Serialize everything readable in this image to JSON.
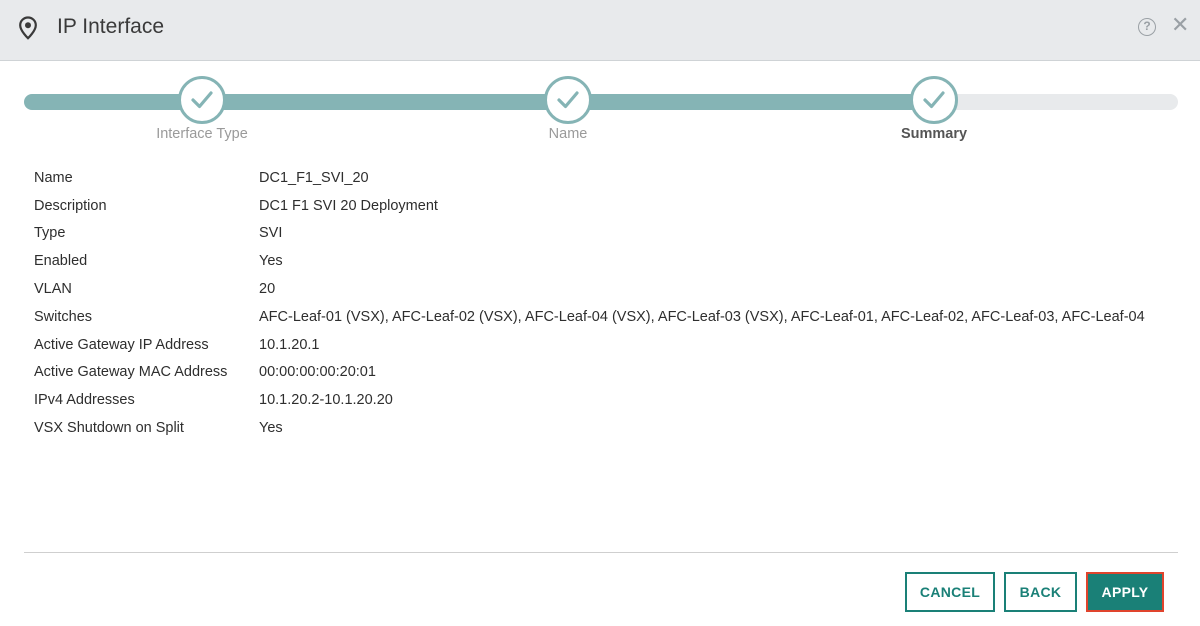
{
  "header": {
    "title": "IP Interface",
    "help_glyph": "?",
    "close_glyph": "✕"
  },
  "stepper": {
    "steps": [
      {
        "label": "Interface Type",
        "state": "complete"
      },
      {
        "label": "Name",
        "state": "complete"
      },
      {
        "label": "Summary",
        "state": "active"
      }
    ]
  },
  "summary": {
    "rows": [
      {
        "key": "Name",
        "value": "DC1_F1_SVI_20"
      },
      {
        "key": "Description",
        "value": "DC1 F1 SVI 20 Deployment"
      },
      {
        "key": "Type",
        "value": "SVI"
      },
      {
        "key": "Enabled",
        "value": "Yes"
      },
      {
        "key": "VLAN",
        "value": "20"
      },
      {
        "key": "Switches",
        "value": "AFC-Leaf-01 (VSX), AFC-Leaf-02 (VSX), AFC-Leaf-04 (VSX), AFC-Leaf-03 (VSX), AFC-Leaf-01, AFC-Leaf-02, AFC-Leaf-03, AFC-Leaf-04"
      },
      {
        "key": "Active Gateway IP Address",
        "value": "10.1.20.1"
      },
      {
        "key": "Active Gateway MAC Address",
        "value": "00:00:00:00:20:01"
      },
      {
        "key": "IPv4 Addresses",
        "value": "10.1.20.2-10.1.20.20"
      },
      {
        "key": "VSX Shutdown on Split",
        "value": "Yes"
      }
    ]
  },
  "footer": {
    "cancel_label": "CANCEL",
    "back_label": "BACK",
    "apply_label": "APPLY"
  },
  "colors": {
    "accent": "#1a8077",
    "progress": "#85b4b5",
    "highlight_border": "#e0442d"
  }
}
